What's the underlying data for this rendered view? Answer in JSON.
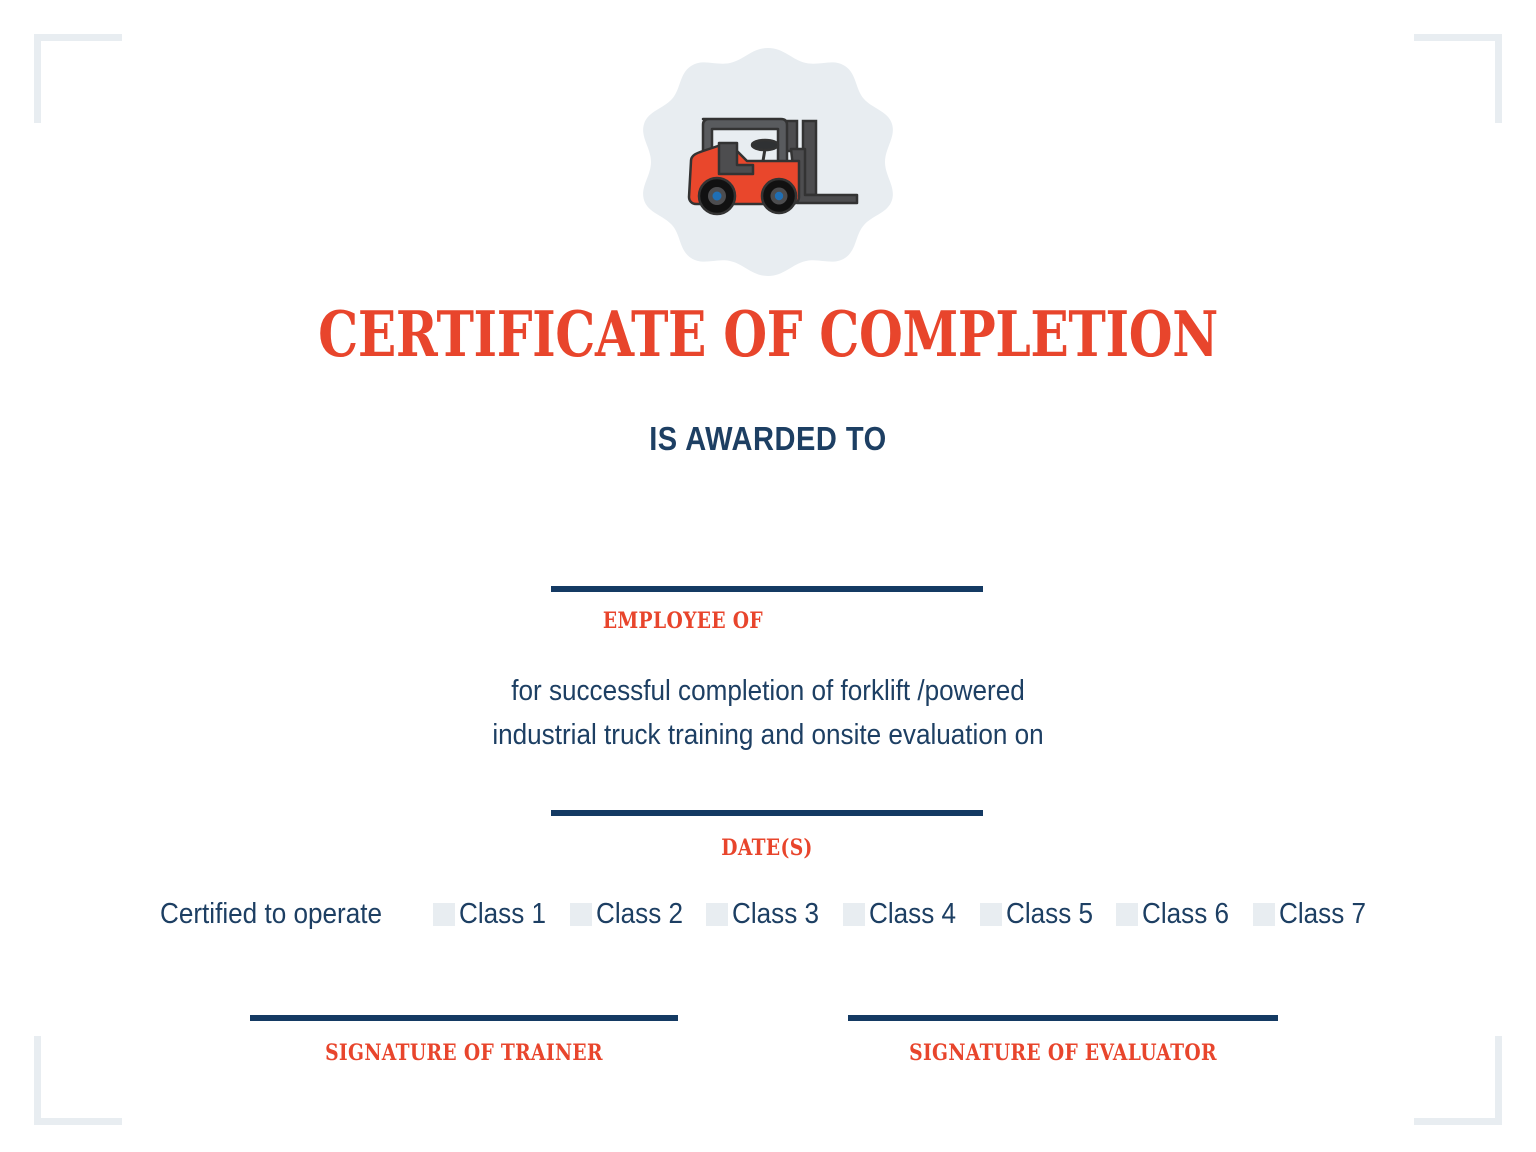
{
  "document": {
    "type": "certificate",
    "title": "CERTIFICATE OF COMPLETION",
    "subtitle": "IS AWARDED TO"
  },
  "colors": {
    "accent_orange": "#e8452c",
    "navy": "#143a63",
    "navy_text": "#1d3f63",
    "light_blue_gray": "#e8edf1",
    "background": "#ffffff"
  },
  "badge": {
    "icon_name": "forklift-icon",
    "blob_color": "#e8edf1",
    "forklift_body_color": "#e9472c",
    "forklift_frame_color": "#4d4d4f",
    "wheel_hub_color": "#1f6fb5"
  },
  "name_field": {
    "value": "",
    "caption": "EMPLOYEE OF"
  },
  "body": {
    "line1": "for successful completion of forklift /powered",
    "line2": "industrial truck training and onsite evaluation on"
  },
  "date_field": {
    "value": "",
    "caption": "DATE(S)"
  },
  "certification": {
    "label": "Certified to operate",
    "classes": [
      {
        "label": "Class 1",
        "checked": false
      },
      {
        "label": "Class 2",
        "checked": false
      },
      {
        "label": "Class 3",
        "checked": false
      },
      {
        "label": "Class 4",
        "checked": false
      },
      {
        "label": "Class 5",
        "checked": false
      },
      {
        "label": "Class 6",
        "checked": false
      },
      {
        "label": "Class 7",
        "checked": false
      }
    ]
  },
  "signatures": {
    "trainer": {
      "value": "",
      "caption": "SIGNATURE OF TRAINER"
    },
    "evaluator": {
      "value": "",
      "caption": "SIGNATURE OF EVALUATOR"
    }
  },
  "decoration": {
    "corner_bracket_color": "#e8edf1",
    "corner_names": [
      "corner-bracket-top-left",
      "corner-bracket-top-right",
      "corner-bracket-bottom-left",
      "corner-bracket-bottom-right"
    ]
  }
}
